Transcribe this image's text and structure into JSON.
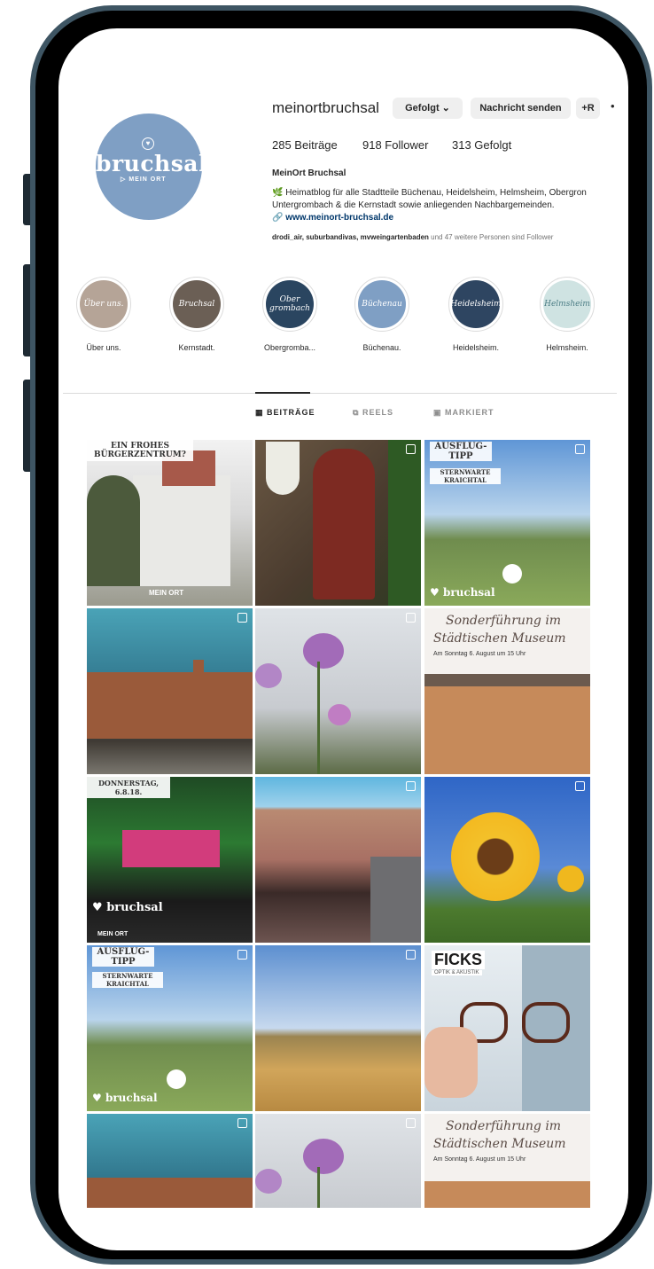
{
  "profile": {
    "username": "meinortbruchsal",
    "follow_button": "Gefolgt",
    "message_button": "Nachricht senden",
    "suggest_icon": "+R",
    "more_icon": "•",
    "posts": "285 Beiträge",
    "followers": "918 Follower",
    "following": "313 Gefolgt",
    "display_name": "MeinOrt Bruchsal",
    "bio_line1": "🌿 Heimatblog für alle Stadtteile Büchenau, Heidelsheim, Helmsheim, Obergron",
    "bio_line2": "Untergrombach & die Kernstadt sowie anliegenden Nachbargemeinden.",
    "link": "www.meinort-bruchsal.de",
    "followed_by": "drodi_air, suburbandivas, mvweingartenbaden",
    "followed_by_suffix": " und 47 weitere Personen sind Follower"
  },
  "avatar": {
    "logo_word": "bruchsal",
    "logo_sub": "MEIN ORT"
  },
  "highlights": [
    {
      "cover": "Über uns.",
      "label": "Über uns.",
      "color": "#b5a497"
    },
    {
      "cover": "Bruchsal",
      "label": "Kernstadt.",
      "color": "#6b5f55"
    },
    {
      "cover": "Ober grombach",
      "label": "Obergromba...",
      "color": "#2a4560"
    },
    {
      "cover": "Büchenau",
      "label": "Büchenau.",
      "color": "#7f9fc4"
    },
    {
      "cover": "Heidelsheim",
      "label": "Heidelsheim.",
      "color": "#2e4561"
    },
    {
      "cover": "Helmsheim",
      "label": "Helmsheim.",
      "color": "#cfe3e2"
    }
  ],
  "tabs": {
    "posts": "BEITRÄGE",
    "reels": "REELS",
    "tagged": "MARKIERT"
  },
  "grid": {
    "p1_caption": "EIN FROHES BÜRGERZENTRUM?",
    "p1_badge": "MEIN ORT",
    "p3_caption1": "AUSFLUG-TIPP",
    "p3_caption2": "STERNWARTE KRAICHTAL",
    "p3_watermark": "bruchsal",
    "p6_title1": "Sonderführung im",
    "p6_title2": "Städtischen Museum",
    "p6_sub": "Am Sonntag 6. August um 15 Uhr",
    "p7_caption": "DONNERSTAG, 6.8.18.",
    "p7_watermark": "bruchsal",
    "p7_badge": "MEIN ORT",
    "p10_caption1": "AUSFLUG-TIPP",
    "p10_caption2": "STERNWARTE KRAICHTAL",
    "p10_watermark": "bruchsal",
    "p12_brand": "FICKS",
    "p12_sub": "OPTIK & AKUSTIK",
    "p15_title1": "Sonderführung im",
    "p15_title2": "Städtischen Museum",
    "p15_sub": "Am Sonntag 6. August um 15 Uhr"
  }
}
